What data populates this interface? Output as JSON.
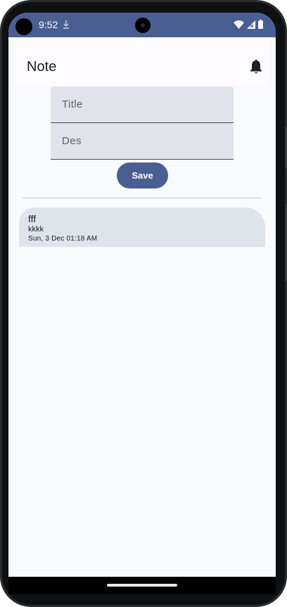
{
  "status_bar": {
    "time": "9:52",
    "icons": [
      "download-icon",
      "wifi-icon",
      "signal-icon",
      "battery-icon"
    ],
    "background_color": "#4b5e91"
  },
  "app_bar": {
    "title": "Note",
    "action_icon": "bell-icon"
  },
  "form": {
    "title_placeholder": "Title",
    "title_value": "",
    "description_placeholder": "Des",
    "description_value": "",
    "save_label": "Save"
  },
  "notes": [
    {
      "title": "fff",
      "description": "kkkk",
      "date": "Sun, 3 Dec 01:18 AM"
    }
  ],
  "colors": {
    "primary": "#4b5e91",
    "card": "#dfe4eb",
    "field": "#e2e2ea"
  }
}
